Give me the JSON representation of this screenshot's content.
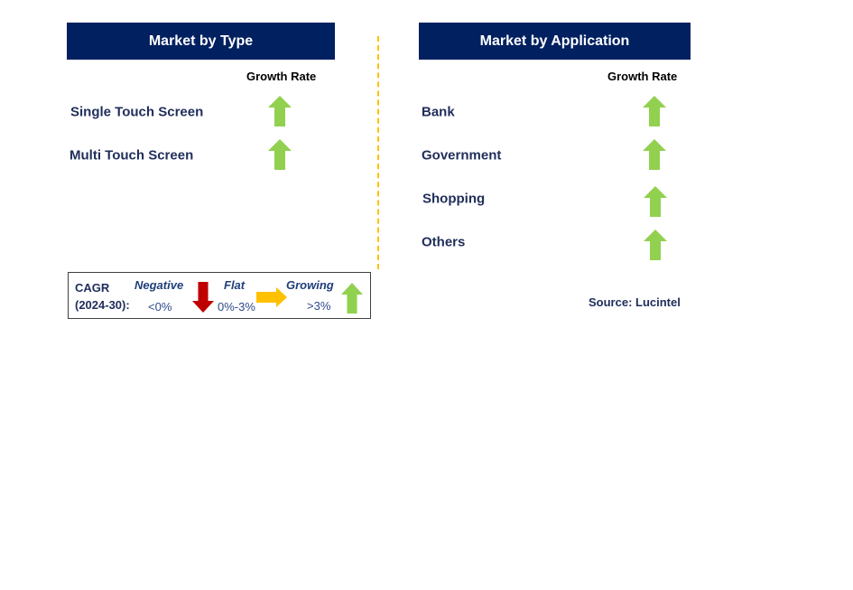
{
  "type_panel": {
    "title": "Market by Type",
    "growth_header": "Growth Rate",
    "items": [
      {
        "label": "Single Touch Screen",
        "trend": "growing"
      },
      {
        "label": "Multi Touch Screen",
        "trend": "growing"
      }
    ]
  },
  "application_panel": {
    "title": "Market by Application",
    "growth_header": "Growth Rate",
    "items": [
      {
        "label": "Bank",
        "trend": "growing"
      },
      {
        "label": "Government",
        "trend": "growing"
      },
      {
        "label": "Shopping",
        "trend": "growing"
      },
      {
        "label": "Others",
        "trend": "growing"
      }
    ]
  },
  "legend": {
    "cagr": "CAGR",
    "period": "(2024-30):",
    "negative": {
      "label": "Negative",
      "range": "<0%",
      "color": "#C00000",
      "icon": "arrow-down"
    },
    "flat": {
      "label": "Flat",
      "range": "0%-3%",
      "color": "#FFC000",
      "icon": "arrow-right"
    },
    "growing": {
      "label": "Growing",
      "range": ">3%",
      "color": "#92D050",
      "icon": "arrow-up"
    }
  },
  "source": "Source: Lucintel",
  "colors": {
    "header": "#002060",
    "divider": "#FFC000"
  }
}
